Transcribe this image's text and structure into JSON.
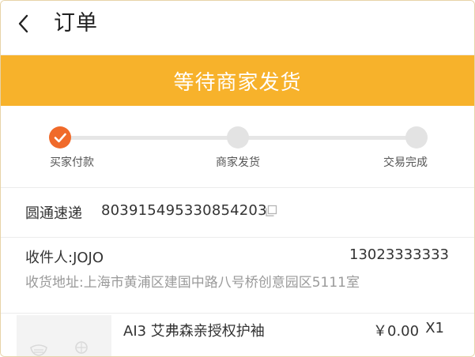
{
  "header": {
    "title": "订单"
  },
  "status": {
    "text": "等待商家发货"
  },
  "progress": {
    "steps": [
      {
        "label": "买家付款",
        "state": "done"
      },
      {
        "label": "商家发货",
        "state": "pending"
      },
      {
        "label": "交易完成",
        "state": "pending"
      }
    ]
  },
  "shipment": {
    "courier": "圆通速递",
    "tracking_number": "803915495330854203"
  },
  "recipient": {
    "name_label": "收件人:JOJO",
    "phone": "13023333333",
    "address": "收货地址:上海市黄浦区建国中路八号桥创意园区5111室"
  },
  "product": {
    "name": "AI3   艾弗森亲授权护袖",
    "price": "￥0.00",
    "quantity": "X1"
  },
  "colors": {
    "accent": "#f7b22b",
    "step_done": "#f06a2a",
    "step_pending": "#e3e3e3",
    "muted_text": "#9a9a9a"
  },
  "icons": {
    "back": "chevron-left-icon",
    "check": "check-icon",
    "copy": "copy-icon"
  }
}
